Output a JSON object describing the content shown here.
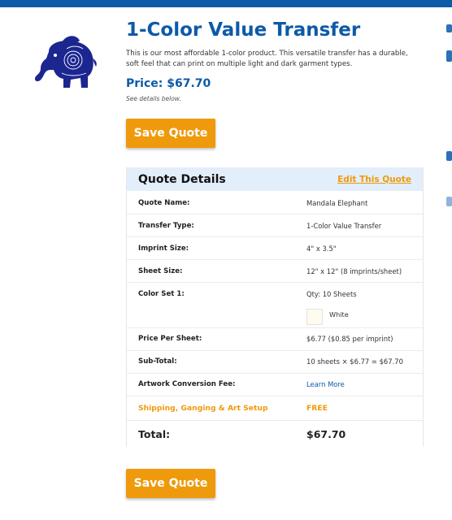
{
  "product": {
    "title": "1-Color Value Transfer",
    "description": "This is our most affordable 1-color product. This versatile transfer has a durable, soft feel that can print on multiple light and dark garment types.",
    "price": "Price: $67.70",
    "details_note": "See details below.",
    "logo_icon": "mandala-elephant-icon"
  },
  "buttons": {
    "save_top": "Save Quote",
    "save_bottom": "Save Quote"
  },
  "quote": {
    "heading": "Quote Details",
    "edit_link": "Edit This Quote",
    "rows": {
      "quote_name": {
        "label": "Quote Name:",
        "value": "Mandala Elephant"
      },
      "transfer_type": {
        "label": "Transfer Type:",
        "value": "1-Color Value Transfer"
      },
      "imprint_size": {
        "label": "Imprint Size:",
        "value": "4\" x 3.5\""
      },
      "sheet_size": {
        "label": "Sheet Size:",
        "value": "12\" x 12\" (8 imprints/sheet)"
      },
      "color_set": {
        "label": "Color Set 1:",
        "value": "Qty: 10 Sheets",
        "swatch_label": "White",
        "swatch_color": "#fffbee"
      },
      "price_per_sheet": {
        "label": "Price Per Sheet:",
        "value": "$6.77 ($0.85 per imprint)"
      },
      "subtotal": {
        "label": "Sub-Total:",
        "value": "10 sheets × $6.77 = $67.70"
      },
      "artwork_fee": {
        "label": "Artwork Conversion Fee:",
        "value": "Learn More"
      },
      "shipping": {
        "label": "Shipping, Ganging & Art Setup",
        "value": "FREE"
      },
      "total": {
        "label": "Total:",
        "value": "$67.70"
      }
    }
  },
  "colors": {
    "brand_blue": "#0d5aa8",
    "accent_orange": "#ef9a0c",
    "header_bg": "#e2eefa"
  }
}
